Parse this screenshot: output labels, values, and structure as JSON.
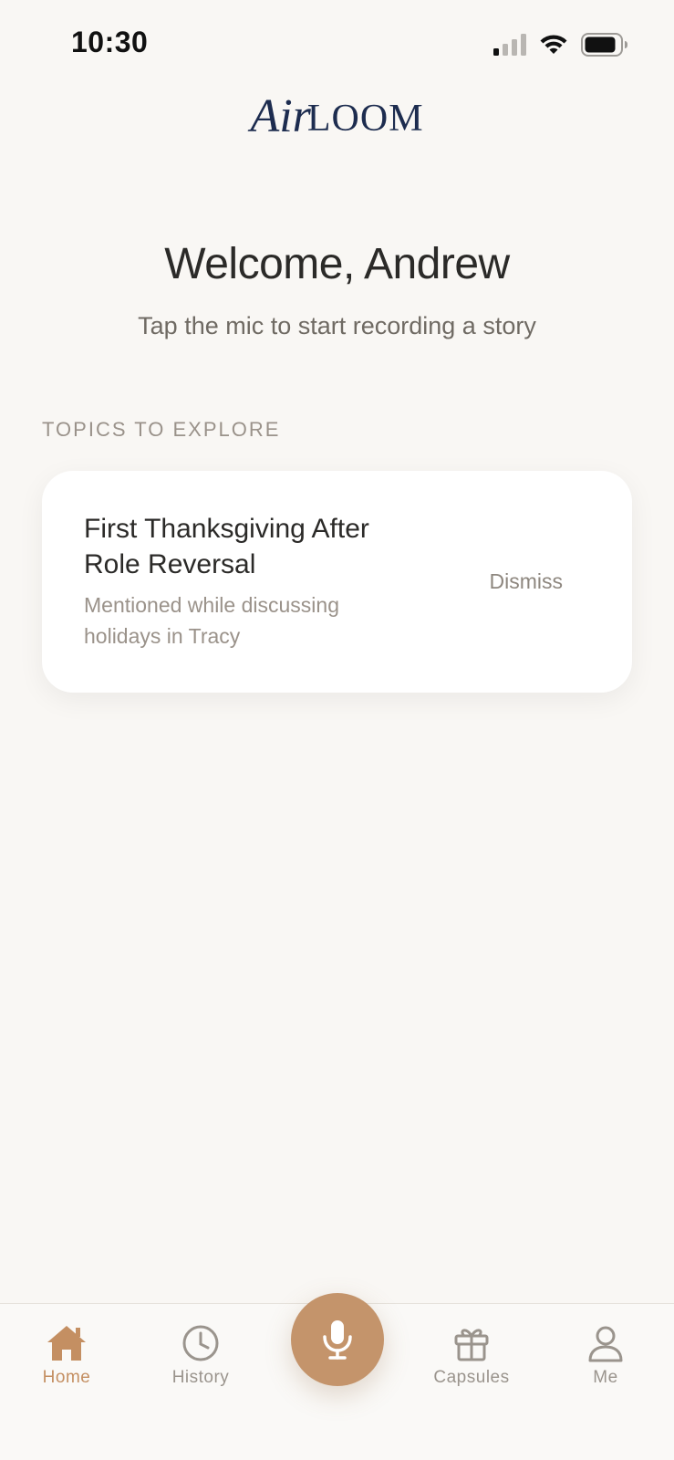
{
  "status_bar": {
    "time": "10:30"
  },
  "logo": {
    "script": "Air",
    "serif": "LOOM",
    "color": "#1d2c4f"
  },
  "welcome": {
    "title": "Welcome, Andrew",
    "subtitle": "Tap the mic to start recording a story"
  },
  "topics": {
    "section_label": "TOPICS TO EXPLORE",
    "cards": [
      {
        "title": "First Thanksgiving After Role Reversal",
        "subtitle": "Mentioned while discussing holidays in Tracy",
        "action": "Dismiss"
      }
    ]
  },
  "tabbar": {
    "accent_color": "#c48f62",
    "tabs": [
      {
        "label": "Home",
        "icon": "home-icon",
        "active": true
      },
      {
        "label": "History",
        "icon": "clock-icon",
        "active": false
      },
      {
        "label": "Capsules",
        "icon": "gift-icon",
        "active": false
      },
      {
        "label": "Me",
        "icon": "person-icon",
        "active": false
      }
    ],
    "center_button": {
      "icon": "microphone-icon"
    }
  }
}
